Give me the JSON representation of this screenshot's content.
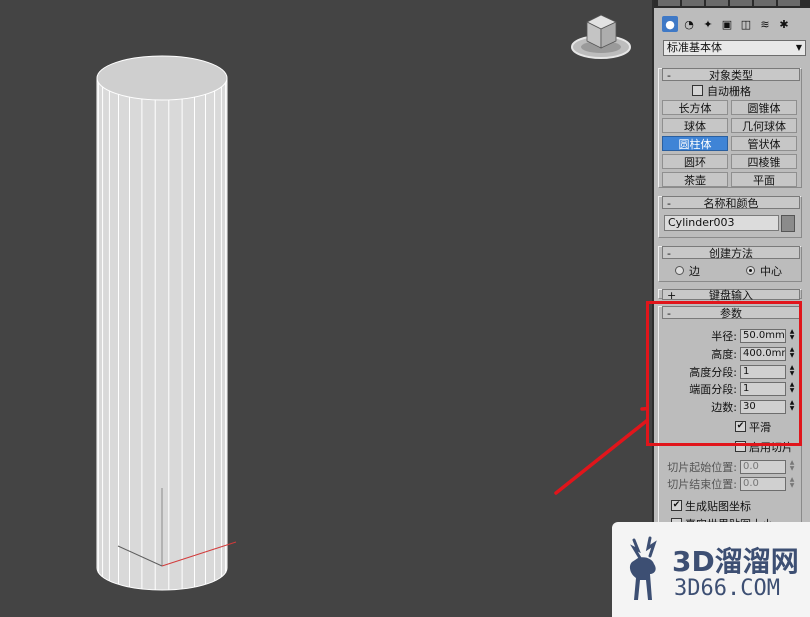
{
  "command_panel": {
    "icon_tabs": [
      "geometry-icon",
      "shapes-icon",
      "lights-icon",
      "cameras-icon",
      "helpers-icon",
      "space-warps-icon",
      "systems-icon"
    ],
    "category_dropdown": {
      "value": "标准基本体"
    }
  },
  "object_type": {
    "title": "对象类型",
    "collapse_sign": "-",
    "autogrid_label": "自动栅格",
    "buttons": [
      "长方体",
      "圆锥体",
      "球体",
      "几何球体",
      "圆柱体",
      "管状体",
      "圆环",
      "四棱锥",
      "茶壶",
      "平面"
    ],
    "active_button": "圆柱体"
  },
  "name_color": {
    "title": "名称和颜色",
    "collapse_sign": "-",
    "name_value": "Cylinder003",
    "color": "#8b8b8b"
  },
  "creation_method": {
    "title": "创建方法",
    "collapse_sign": "-",
    "options": [
      "边",
      "中心"
    ],
    "selected": "中心"
  },
  "keyboard_entry": {
    "title": "键盘输入",
    "collapse_sign": "+"
  },
  "parameters": {
    "title": "参数",
    "collapse_sign": "-",
    "radius_label": "半径:",
    "radius_value": "50.0mm",
    "height_label": "高度:",
    "height_value": "400.0mm",
    "height_segments_label": "高度分段:",
    "height_segments_value": "1",
    "cap_segments_label": "端面分段:",
    "cap_segments_value": "1",
    "sides_label": "边数:",
    "sides_value": "30",
    "smooth_label": "平滑",
    "smooth_checked": true,
    "slice_on_label": "启用切片",
    "slice_from_label": "切片起始位置:",
    "slice_from_value": "0.0",
    "slice_to_label": "切片结束位置:",
    "slice_to_value": "0.0",
    "gen_mapping_label": "生成贴图坐标",
    "real_world_label": "真实世界贴图大小"
  },
  "watermark": {
    "brand": "3D溜溜网",
    "site": "3D66.COM"
  },
  "colors": {
    "viewport_bg": "#444444",
    "panel_bg": "#bcbcbc",
    "active_blue": "#3f84d6",
    "highlight_red": "#e1151b"
  }
}
